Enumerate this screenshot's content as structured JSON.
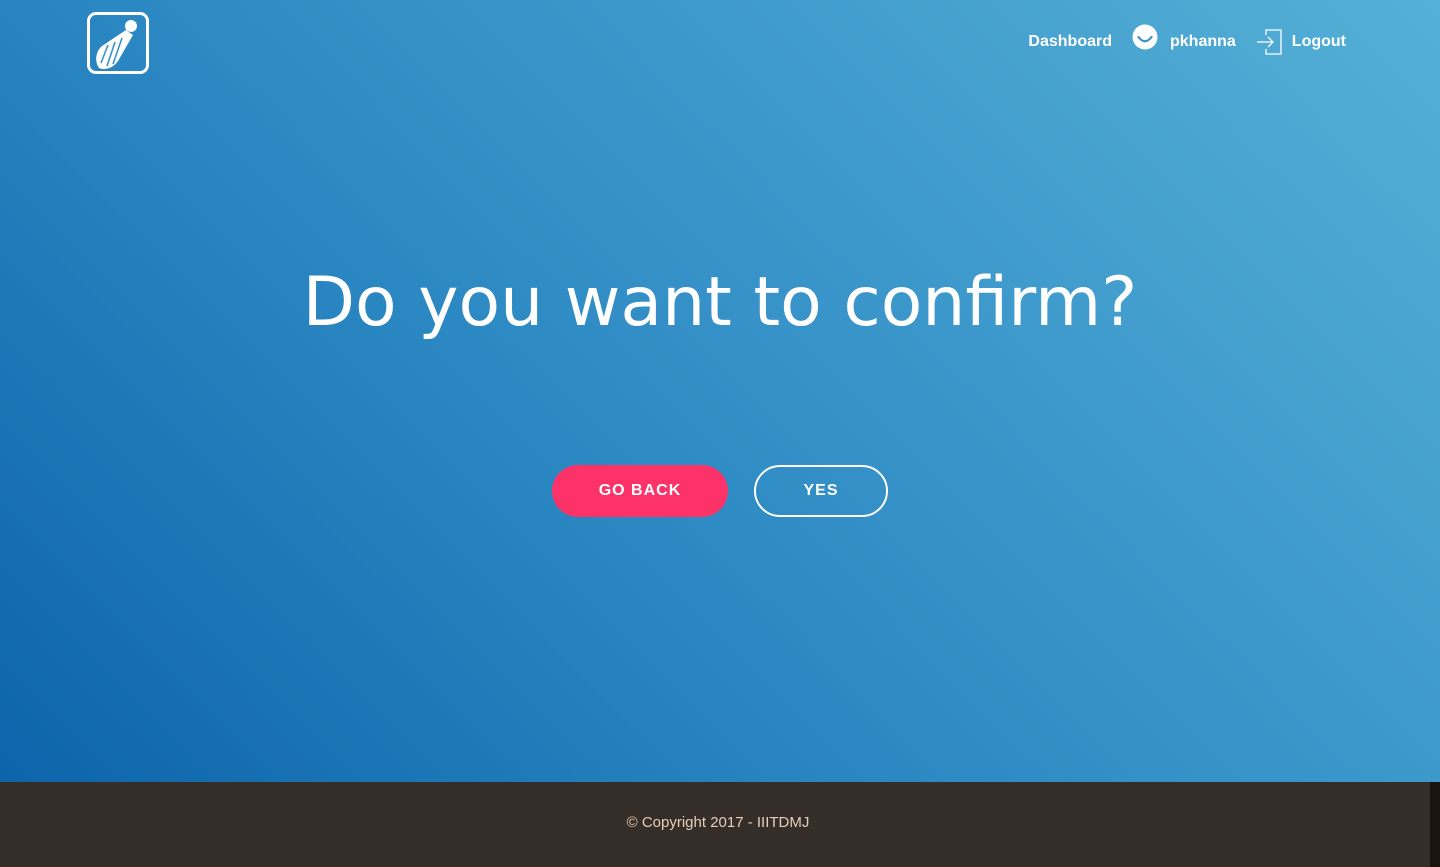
{
  "header": {
    "logo_icon": "shuttlecock-icon",
    "nav": {
      "dashboard_label": "Dashboard",
      "username": "pkhanna",
      "user_icon": "smiley-avatar-icon",
      "logout_label": "Logout",
      "logout_icon": "logout-door-icon"
    }
  },
  "main": {
    "headline": "Do you want to confirm?",
    "go_back_label": "GO BACK",
    "yes_label": "YES"
  },
  "footer": {
    "copyright": "© Copyright 2017 - IIITDMJ"
  },
  "colors": {
    "hero_gradient_light": "#55b0d6",
    "hero_gradient_dark": "#0d64aa",
    "primary_button": "#fd3268",
    "footer_background": "#352d27",
    "footer_text": "#e4cfbe"
  }
}
